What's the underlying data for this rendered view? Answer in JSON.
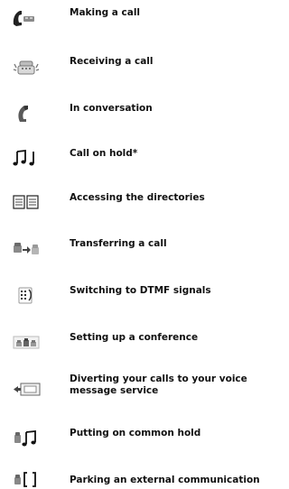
{
  "items": [
    {
      "label": "Making a call",
      "icon": "handset-lifted-icon"
    },
    {
      "label": "Receiving a call",
      "icon": "ringing-phone-icon"
    },
    {
      "label": "In conversation",
      "icon": "handset-icon"
    },
    {
      "label": "Call on hold*",
      "icon": "music-notes-icon"
    },
    {
      "label": "Accessing the directories",
      "icon": "directory-book-icon"
    },
    {
      "label": "Transferring a call",
      "icon": "transfer-icon"
    },
    {
      "label": "Switching to DTMF signals",
      "icon": "dtmf-icon"
    },
    {
      "label": "Setting up a conference",
      "icon": "conference-icon"
    },
    {
      "label": "Diverting your calls to your voice\nmessage service",
      "icon": "voicemail-divert-icon"
    },
    {
      "label": "Putting on common hold",
      "icon": "common-hold-icon"
    },
    {
      "label": "Parking an external communication",
      "icon": "park-call-icon"
    }
  ]
}
